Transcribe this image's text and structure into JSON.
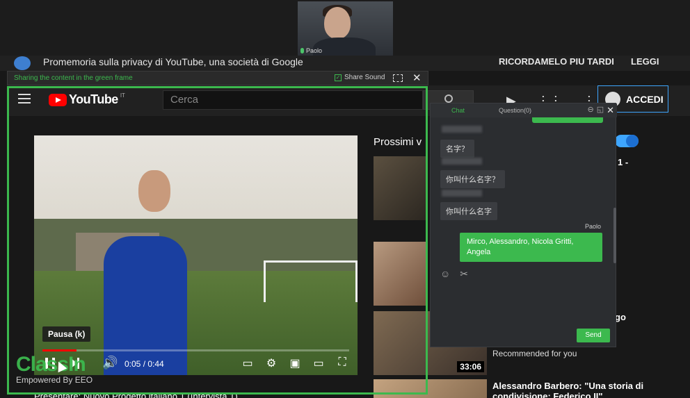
{
  "webcam": {
    "name": "Paolo"
  },
  "privacy": {
    "text": "Promemoria sulla privacy di YouTube, una società di Google",
    "later": "RICORDAMELO PIU TARDI",
    "read": "LEGGI"
  },
  "share": {
    "hint": "Sharing the content in the green frame",
    "sound": "Share Sound",
    "sound_checked": "✓"
  },
  "youtube": {
    "logo_word": "YouTube",
    "logo_region": "IT",
    "search_placeholder": "Cerca",
    "accedi": "ACCEDI"
  },
  "player": {
    "tooltip": "Pausa (k)",
    "time": "0:05 / 0:44",
    "progress_fraction": 0.11
  },
  "sidebar": {
    "heading": "Prossimi v",
    "frag1": "1 -",
    "frag2": "go",
    "duration": "33:06",
    "recommended": "Recommended for you",
    "next_title": "Alessandro Barbero: \"Una storia di condivisione: Federico II\"",
    "bottom_text": "Presentare: Nuovo Progetto italiano 1 (Intervista 1)"
  },
  "chat": {
    "tab_chat": "Chat",
    "tab_question": "Question(0)",
    "messages": [
      {
        "text": "名字？"
      },
      {
        "text": "你叫什么名字？"
      },
      {
        "text": "你叫什么名字"
      }
    ],
    "me_name": "Paolo",
    "me_message": "Mirco, Alessandro, Nicola Gritti, Angela",
    "send": "Send"
  },
  "watermark": {
    "brand": "ClassIn",
    "sub": "Empowered By EEO"
  },
  "colors": {
    "green": "#3cb94e",
    "youtube_red": "#ff0000",
    "accent_blue": "#3ea6ff"
  }
}
